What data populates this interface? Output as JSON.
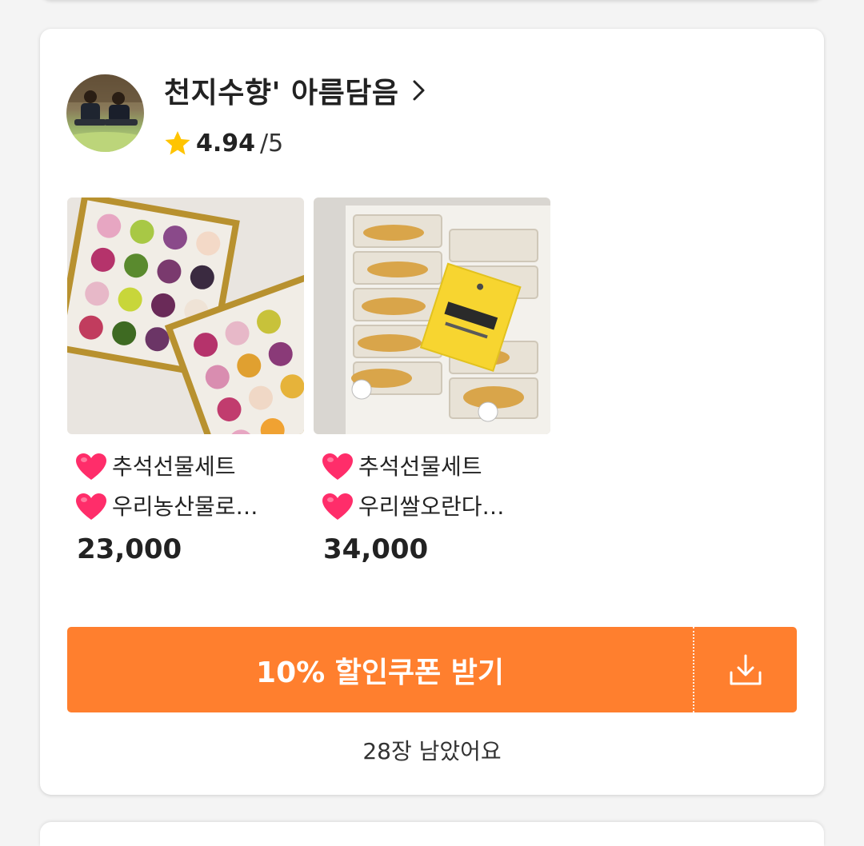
{
  "seller": {
    "name": "천지수향' 아름담음",
    "rating": "4.94",
    "rating_max": "/5"
  },
  "products": [
    {
      "title_line1": "추석선물세트",
      "title_line2": " 우리농산물로…",
      "price": "23,000"
    },
    {
      "title_line1": "추석선물세트",
      "title_line2": " 우리쌀오란다…",
      "price": "34,000"
    }
  ],
  "coupon": {
    "button_label": "10% 할인쿠폰 받기",
    "remaining": "28장 남았어요"
  },
  "icons": {
    "star": "star-icon",
    "heart": "heart-icon",
    "chevron": "chevron-right-icon",
    "download": "download-icon"
  },
  "colors": {
    "accent": "#ff7f2e",
    "star": "#ffc400",
    "heart": "#ff2d6a"
  }
}
